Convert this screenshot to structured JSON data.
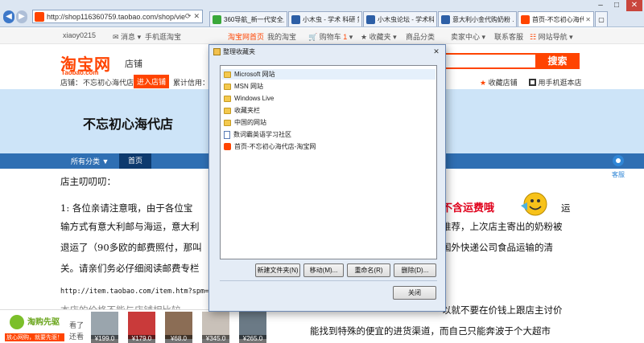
{
  "browser": {
    "address_url": "http://shop116360759.taobao.com/shop/view_sh",
    "window_controls": [
      "minimize",
      "maximize",
      "close"
    ],
    "tabs": [
      {
        "title": "360导航_新一代安全上...",
        "icon": "green"
      },
      {
        "title": "小木虫 - 学术 科研 第...",
        "icon": "blue"
      },
      {
        "title": "小木虫论坛 - 学术科研...",
        "icon": "blue"
      },
      {
        "title": "意大利小金代购奶粉 ...",
        "icon": "blue"
      },
      {
        "title": "首页-不忘初心海代店",
        "icon": "taobao",
        "active": true
      }
    ]
  },
  "sitenav": {
    "user": "xiaoy0215",
    "messages": "消息",
    "mobile": "手机逛淘宝",
    "home": "淘宝网首页",
    "my_taobao": "我的淘宝",
    "cart": "购物车",
    "cart_count": "1",
    "favorites": "收藏夹",
    "categories": "商品分类",
    "seller": "卖家中心",
    "service": "联系客服",
    "sitemap": "网站导航"
  },
  "header": {
    "logo": "淘宝网",
    "logo_sub": "Taobao.com",
    "shop_label": "店铺",
    "search_button": "搜索",
    "shop_line_label": "店铺：",
    "shop_line_name": "不忘初心海代店",
    "enter_shop": "进入店铺",
    "credit_label": "累计信用：",
    "collect": "收藏店铺",
    "mobile_shop": "用手机逛本店"
  },
  "banner": {
    "shop_title": "不忘初心海代店",
    "menu_all": "所有分类 ▼",
    "menu_home": "首页"
  },
  "content": {
    "heading": "店主叨叨叨：",
    "line1_a": "1: 各位亲请注意哦，由于各位宝",
    "line1_red": "不含运费哦",
    "line1_end": "运",
    "line2_a": "输方式有意大利邮与海运，意大利",
    "line2_b": "推荐，上次店主寄出的奶粉被",
    "line3_a": "退运了（90多欧的邮费照付，那叫",
    "line3_b": "国外快递公司食品运输的清",
    "line4": "关。请亲们务必仔细阅读邮费专栏",
    "url": "http://item.taobao.com/item.htm?spm=a",
    "line5_a": "本店的价格不能与店铺相比较",
    "line5_b": "以就不要在价钱上跟店主讨价",
    "line6": "能找到特殊的便宜的进货渠道，而自己只能奔波于个大超市"
  },
  "kefu": {
    "label": "客服"
  },
  "adbar": {
    "brand": "淘购先驱",
    "slogan": "放心网购，就要先驱！",
    "look_label": "看了",
    "also_label": "还看",
    "prices": [
      "¥199.0",
      "¥179.0",
      "¥68.0",
      "¥345.0",
      "¥265.0"
    ]
  },
  "dialog": {
    "title": "整理收藏夹",
    "close": "✕",
    "items": [
      {
        "label": "Microsoft 网站",
        "icon": "folder",
        "selected": true
      },
      {
        "label": "MSN 网站",
        "icon": "folder"
      },
      {
        "label": "Windows Live",
        "icon": "folder"
      },
      {
        "label": "收藏夹栏",
        "icon": "folder"
      },
      {
        "label": "中国的网站",
        "icon": "folder"
      },
      {
        "label": "数词霸英语学习社区",
        "icon": "page"
      },
      {
        "label": "首页-不忘初心海代店-淘宝网",
        "icon": "taobao"
      }
    ],
    "buttons": {
      "new_folder": "新建文件夹(N)",
      "move": "移动(M)...",
      "rename": "重命名(R)",
      "delete": "删除(D)...",
      "close": "关闭"
    }
  }
}
